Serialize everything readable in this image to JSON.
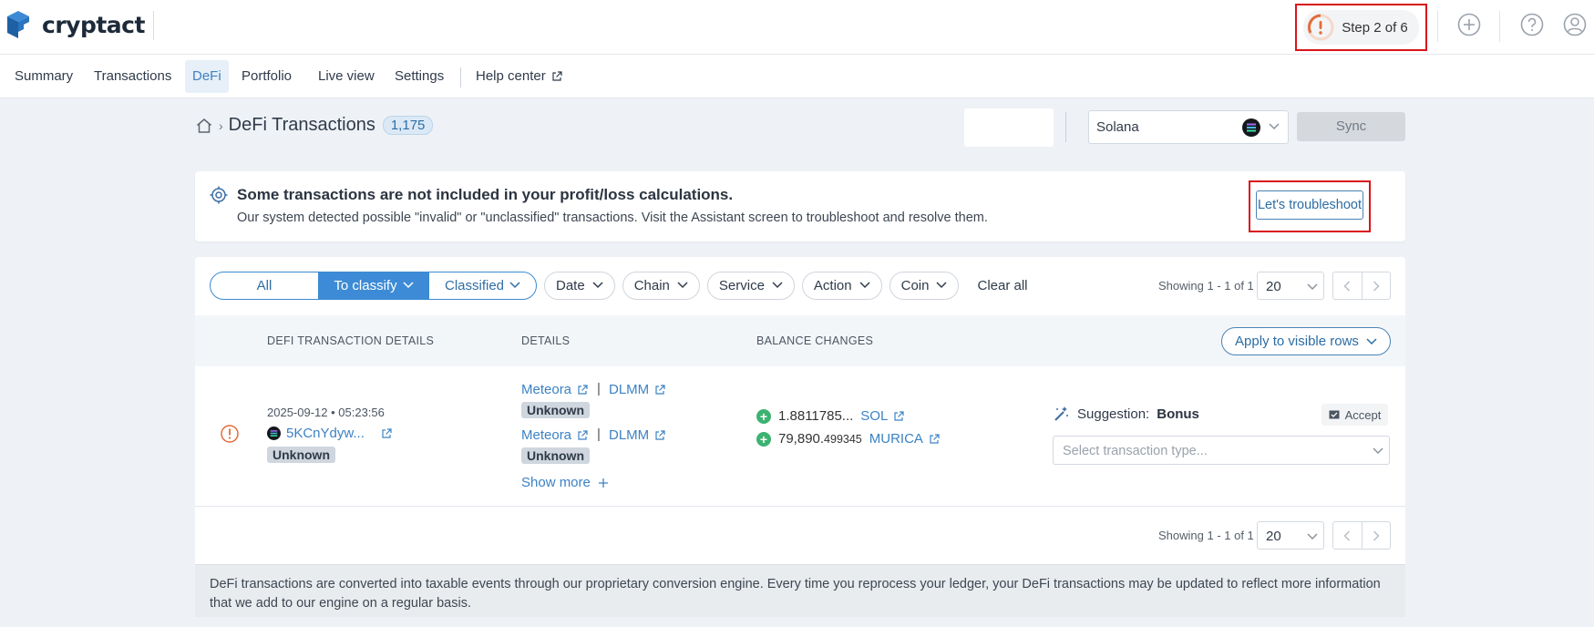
{
  "app": {
    "name": "cryptact"
  },
  "header": {
    "step_label": "Step 2 of 6"
  },
  "nav": {
    "items": [
      {
        "label": "Summary"
      },
      {
        "label": "Transactions"
      },
      {
        "label": "DeFi"
      },
      {
        "label": "Portfolio"
      },
      {
        "label": "Live view"
      },
      {
        "label": "Settings"
      },
      {
        "label": "Help center"
      }
    ],
    "active": "DeFi"
  },
  "page": {
    "title": "DeFi Transactions",
    "count": "1,175",
    "chain": "Solana",
    "sync_label": "Sync"
  },
  "alert": {
    "title": "Some transactions are not included in your profit/loss calculations.",
    "description": "Our system detected possible \"invalid\" or \"unclassified\" transactions. Visit the Assistant screen to troubleshoot and resolve them.",
    "button": "Let's troubleshoot"
  },
  "filters": {
    "segments": [
      "All",
      "To classify",
      "Classified"
    ],
    "chips": [
      "Date",
      "Chain",
      "Service",
      "Action",
      "Coin"
    ],
    "clear_all": "Clear all",
    "showing": "Showing 1 - 1 of 1",
    "per_page": "20"
  },
  "table": {
    "headers": [
      "DEFI TRANSACTION DETAILS",
      "DETAILS",
      "BALANCE CHANGES"
    ],
    "apply_label": "Apply to visible rows",
    "rows": [
      {
        "date": "2025-09-12 • 05:23:56",
        "hash": "5KCnYdyw...",
        "status": "Unknown",
        "details": [
          {
            "protocol": "Meteora",
            "pool": "DLMM",
            "tag": "Unknown"
          },
          {
            "protocol": "Meteora",
            "pool": "DLMM",
            "tag": "Unknown"
          }
        ],
        "show_more": "Show more",
        "balances": [
          {
            "amount_main": "1.8811785...",
            "amount_small": "",
            "coin": "SOL"
          },
          {
            "amount_main": "79,890.",
            "amount_small": "499345",
            "coin": "MURICA"
          }
        ],
        "suggestion_label": "Suggestion:",
        "suggestion_value": "Bonus",
        "accept_label": "Accept",
        "type_placeholder": "Select transaction type..."
      }
    ]
  },
  "bottom_pager": {
    "showing": "Showing 1 - 1 of 1",
    "per_page": "20"
  },
  "footer_note": "DeFi transactions are converted into taxable events through our proprietary conversion engine. Every time you reprocess your ledger, your DeFi transactions may be updated to reflect more information that we add to our engine on a regular basis.",
  "colors": {
    "accent": "#3d8bd6",
    "highlight_border": "#d9151b",
    "warning": "#e36b3a",
    "positive": "#3cb371"
  }
}
